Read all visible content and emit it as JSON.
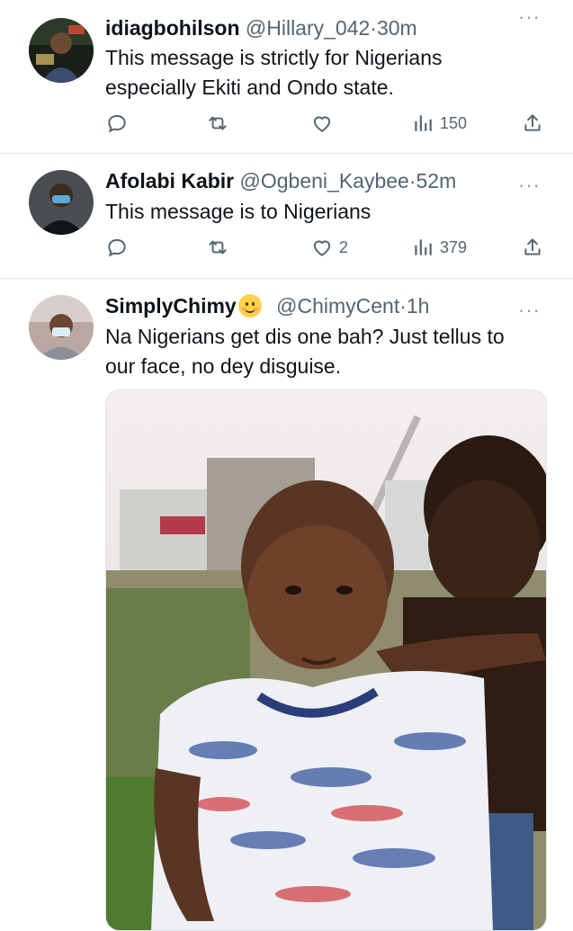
{
  "tweets": [
    {
      "name": "idiagbohilson",
      "handle": "@Hillary_042",
      "separator": "·",
      "time": "30m",
      "text": "This message is strictly for Nigerians especially Ekiti and Ondo state.",
      "likes": "",
      "views": "150"
    },
    {
      "name": "Afolabi Kabir",
      "handle": "@Ogbeni_Kaybee",
      "separator": "·",
      "time": "52m",
      "text": "This message is to Nigerians",
      "likes": "2",
      "views": "379"
    },
    {
      "name": "SimplyChimy",
      "emoji": "smiling-face-emoji",
      "handle": "@ChimyCent",
      "separator": "·",
      "time": "1h",
      "text": "Na Nigerians get dis one bah? Just tellus to our face, no dey disguise.",
      "media": "photo of two young boys"
    }
  ],
  "more_label": "···",
  "colors": {
    "text": "#0f1419",
    "secondary": "#536471",
    "divider": "#e6e9ec"
  }
}
